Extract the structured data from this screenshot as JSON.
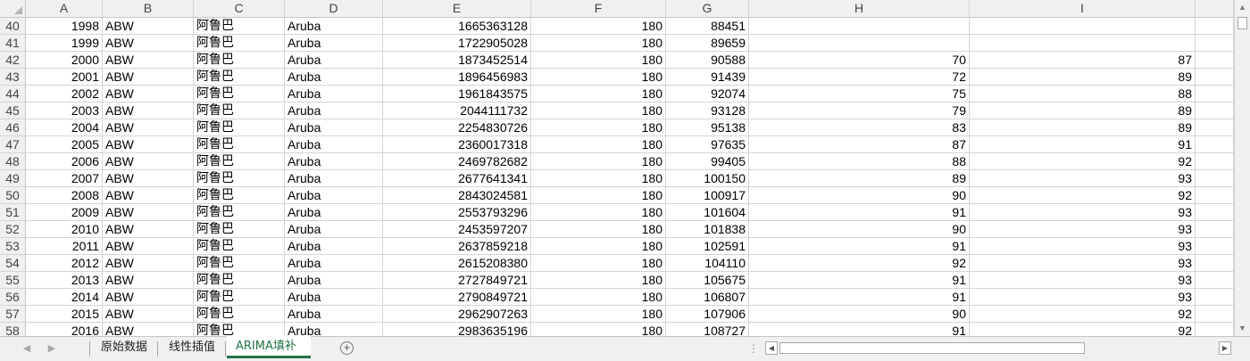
{
  "columns": [
    "A",
    "B",
    "C",
    "D",
    "E",
    "F",
    "G",
    "H",
    "I"
  ],
  "rows": [
    {
      "n": "40",
      "a": "1998",
      "b": "ABW",
      "c": "阿鲁巴",
      "d": "Aruba",
      "e": "1665363128",
      "f": "180",
      "g": "88451",
      "h": "",
      "i": ""
    },
    {
      "n": "41",
      "a": "1999",
      "b": "ABW",
      "c": "阿鲁巴",
      "d": "Aruba",
      "e": "1722905028",
      "f": "180",
      "g": "89659",
      "h": "",
      "i": ""
    },
    {
      "n": "42",
      "a": "2000",
      "b": "ABW",
      "c": "阿鲁巴",
      "d": "Aruba",
      "e": "1873452514",
      "f": "180",
      "g": "90588",
      "h": "70",
      "i": "87"
    },
    {
      "n": "43",
      "a": "2001",
      "b": "ABW",
      "c": "阿鲁巴",
      "d": "Aruba",
      "e": "1896456983",
      "f": "180",
      "g": "91439",
      "h": "72",
      "i": "89"
    },
    {
      "n": "44",
      "a": "2002",
      "b": "ABW",
      "c": "阿鲁巴",
      "d": "Aruba",
      "e": "1961843575",
      "f": "180",
      "g": "92074",
      "h": "75",
      "i": "88"
    },
    {
      "n": "45",
      "a": "2003",
      "b": "ABW",
      "c": "阿鲁巴",
      "d": "Aruba",
      "e": "2044111732",
      "f": "180",
      "g": "93128",
      "h": "79",
      "i": "89"
    },
    {
      "n": "46",
      "a": "2004",
      "b": "ABW",
      "c": "阿鲁巴",
      "d": "Aruba",
      "e": "2254830726",
      "f": "180",
      "g": "95138",
      "h": "83",
      "i": "89"
    },
    {
      "n": "47",
      "a": "2005",
      "b": "ABW",
      "c": "阿鲁巴",
      "d": "Aruba",
      "e": "2360017318",
      "f": "180",
      "g": "97635",
      "h": "87",
      "i": "91"
    },
    {
      "n": "48",
      "a": "2006",
      "b": "ABW",
      "c": "阿鲁巴",
      "d": "Aruba",
      "e": "2469782682",
      "f": "180",
      "g": "99405",
      "h": "88",
      "i": "92"
    },
    {
      "n": "49",
      "a": "2007",
      "b": "ABW",
      "c": "阿鲁巴",
      "d": "Aruba",
      "e": "2677641341",
      "f": "180",
      "g": "100150",
      "h": "89",
      "i": "93"
    },
    {
      "n": "50",
      "a": "2008",
      "b": "ABW",
      "c": "阿鲁巴",
      "d": "Aruba",
      "e": "2843024581",
      "f": "180",
      "g": "100917",
      "h": "90",
      "i": "92"
    },
    {
      "n": "51",
      "a": "2009",
      "b": "ABW",
      "c": "阿鲁巴",
      "d": "Aruba",
      "e": "2553793296",
      "f": "180",
      "g": "101604",
      "h": "91",
      "i": "93"
    },
    {
      "n": "52",
      "a": "2010",
      "b": "ABW",
      "c": "阿鲁巴",
      "d": "Aruba",
      "e": "2453597207",
      "f": "180",
      "g": "101838",
      "h": "90",
      "i": "93"
    },
    {
      "n": "53",
      "a": "2011",
      "b": "ABW",
      "c": "阿鲁巴",
      "d": "Aruba",
      "e": "2637859218",
      "f": "180",
      "g": "102591",
      "h": "91",
      "i": "93"
    },
    {
      "n": "54",
      "a": "2012",
      "b": "ABW",
      "c": "阿鲁巴",
      "d": "Aruba",
      "e": "2615208380",
      "f": "180",
      "g": "104110",
      "h": "92",
      "i": "93"
    },
    {
      "n": "55",
      "a": "2013",
      "b": "ABW",
      "c": "阿鲁巴",
      "d": "Aruba",
      "e": "2727849721",
      "f": "180",
      "g": "105675",
      "h": "91",
      "i": "93"
    },
    {
      "n": "56",
      "a": "2014",
      "b": "ABW",
      "c": "阿鲁巴",
      "d": "Aruba",
      "e": "2790849721",
      "f": "180",
      "g": "106807",
      "h": "91",
      "i": "93"
    },
    {
      "n": "57",
      "a": "2015",
      "b": "ABW",
      "c": "阿鲁巴",
      "d": "Aruba",
      "e": "2962907263",
      "f": "180",
      "g": "107906",
      "h": "90",
      "i": "92"
    },
    {
      "n": "58",
      "a": "2016",
      "b": "ABW",
      "c": "阿鲁巴",
      "d": "Aruba",
      "e": "2983635196",
      "f": "180",
      "g": "108727",
      "h": "91",
      "i": "92"
    }
  ],
  "sheet_tabs": [
    {
      "label": "原始数据",
      "active": false
    },
    {
      "label": "线性插值",
      "active": false
    },
    {
      "label": "ARIMA填补",
      "active": true
    }
  ],
  "icons": {
    "nav_prev": "chevron-left-icon",
    "nav_next": "chevron-right-icon",
    "add_sheet": "plus-circle-icon",
    "select_all": "select-all-triangle-icon"
  },
  "colors": {
    "active_tab": "#217346",
    "header_bg": "#f0f0f0",
    "gridline": "#d4d4d4"
  }
}
